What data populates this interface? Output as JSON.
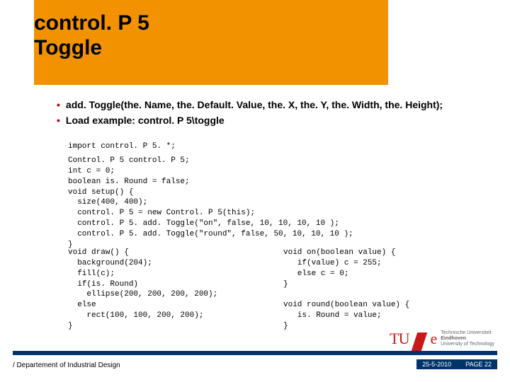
{
  "title_line1": "control. P 5",
  "title_line2": "Toggle",
  "bullets": [
    "add. Toggle(the. Name, the. Default. Value, the. X, the. Y, the. Width, the. Height);",
    "Load example: control. P 5\\toggle"
  ],
  "code_import": "import control. P 5. *;",
  "code_setup": "Control. P 5 control. P 5;\nint c = 0;\nboolean is. Round = false;\nvoid setup() {\n  size(400, 400);\n  control. P 5 = new Control. P 5(this);\n  control. P 5. add. Toggle(\"on\", false, 10, 10, 10, 10 );\n  control. P 5. add. Toggle(\"round\", false, 50, 10, 10, 10 );\n}",
  "code_draw": "void draw() {\n  background(204);\n  fill(c);\n  if(is. Round)\n    ellipse(200, 200, 200, 200);\n  else\n    rect(100, 100, 200, 200);\n}",
  "code_callbacks": "void on(boolean value) {\n   if(value) c = 255;\n   else c = 0;\n}\n\nvoid round(boolean value) {\n   is. Round = value;\n}",
  "logo_mark": "TU",
  "logo_e": "e",
  "logo_text_l1": "Technische Universiteit",
  "logo_text_l2": "Eindhoven",
  "logo_text_l3": "University of Technology",
  "dept": "/ Departement of Industrial Design",
  "footer_date": "25-5-2010",
  "footer_page": "PAGE 22"
}
